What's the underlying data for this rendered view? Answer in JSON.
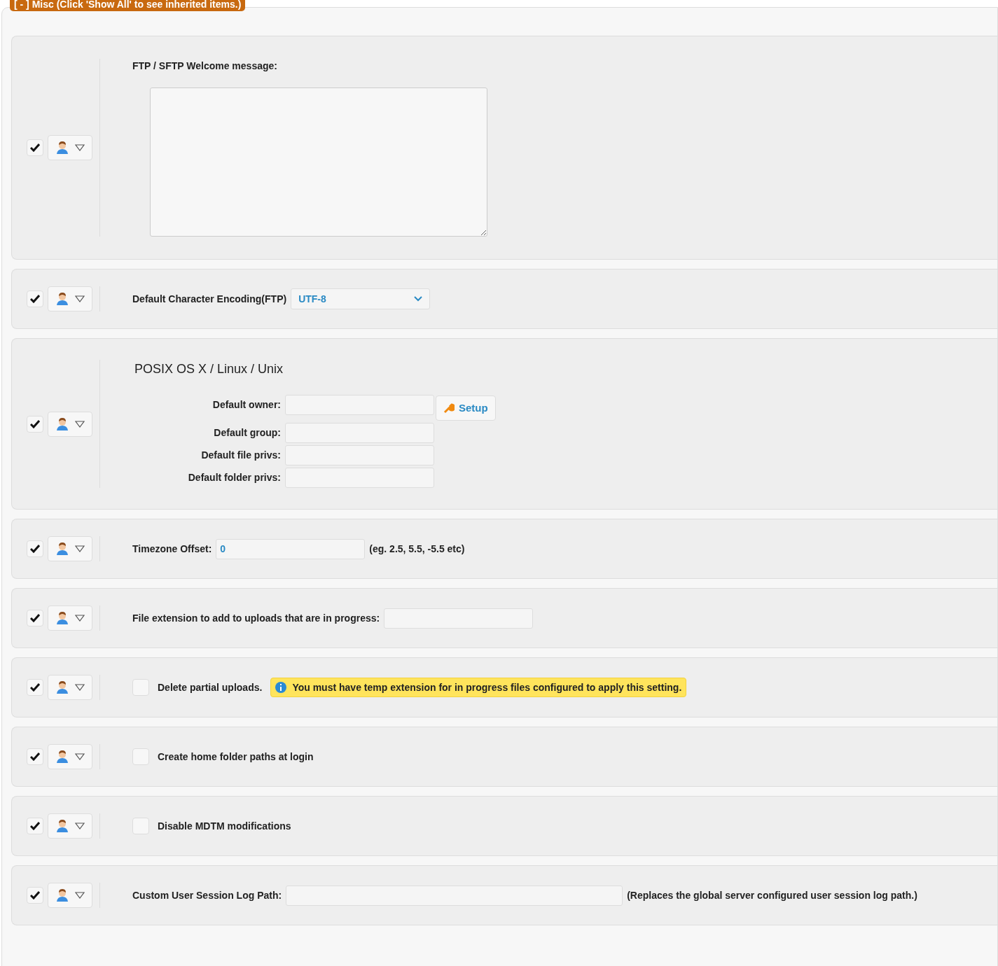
{
  "section_header": "[ - ] Misc (Click 'Show All' to see inherited items.)",
  "rows": [
    {
      "kind": "textarea",
      "checked": true,
      "label": "FTP / SFTP Welcome message:",
      "value": ""
    },
    {
      "kind": "select",
      "checked": true,
      "label": "Default Character Encoding(FTP)",
      "value": "UTF-8"
    },
    {
      "kind": "posix",
      "checked": true,
      "title": "POSIX OS X / Linux / Unix",
      "button": "Setup",
      "fields": [
        {
          "label": "Default owner:"
        },
        {
          "label": "Default group:"
        },
        {
          "label": "Default file privs:"
        },
        {
          "label": "Default folder privs:"
        }
      ]
    },
    {
      "kind": "input",
      "checked": true,
      "label": "Timezone Offset:",
      "value": "0",
      "hint": "(eg. 2.5, 5.5, -5.5 etc)",
      "wide": false
    },
    {
      "kind": "input",
      "checked": true,
      "label": "File extension to add to uploads that are in progress:",
      "value": "",
      "wide": false
    },
    {
      "kind": "checkbox",
      "checked": true,
      "label": "Delete partial uploads.",
      "on": false,
      "note": "You must have temp extension for in progress files configured to apply this setting."
    },
    {
      "kind": "checkbox",
      "checked": true,
      "label": "Create home folder paths at login",
      "on": false
    },
    {
      "kind": "checkbox",
      "checked": true,
      "label": "Disable MDTM modifications",
      "on": false
    },
    {
      "kind": "input",
      "checked": true,
      "label": "Custom User Session Log Path:",
      "value": "",
      "hint": "(Replaces the global server configured user session log path.)",
      "wide": true
    }
  ]
}
